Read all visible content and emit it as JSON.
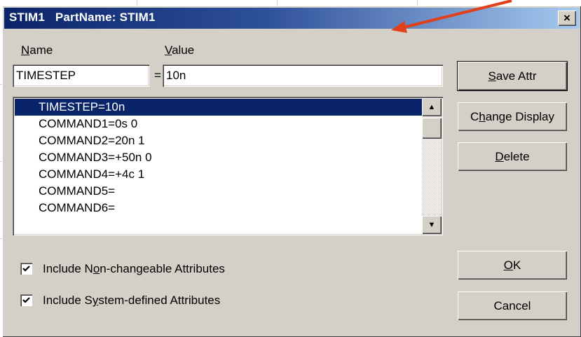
{
  "window": {
    "title": "STIM1   PartName: STIM1",
    "close_label": "×"
  },
  "name_label": "Name",
  "value_label": "Value",
  "name_field": {
    "value": "TIMESTEP"
  },
  "equals": "=",
  "value_field": {
    "value": "10n"
  },
  "attributes": [
    {
      "text": "TIMESTEP=10n",
      "selected": true
    },
    {
      "text": "COMMAND1=0s 0",
      "selected": false
    },
    {
      "text": "COMMAND2=20n 1",
      "selected": false
    },
    {
      "text": "COMMAND3=+50n 0",
      "selected": false
    },
    {
      "text": "COMMAND4=+4c 1",
      "selected": false
    },
    {
      "text": "COMMAND5=",
      "selected": false
    },
    {
      "text": "COMMAND6=",
      "selected": false
    }
  ],
  "buttons": {
    "save_attr": "Save Attr",
    "change_display": "Change Display",
    "delete": "Delete",
    "ok": "OK",
    "cancel": "Cancel"
  },
  "checkboxes": {
    "non_changeable": {
      "label": "Include Non-changeable Attributes",
      "checked": true
    },
    "system_defined": {
      "label": "Include System-defined Attributes",
      "checked": true
    }
  },
  "annotation_arrow_color": "#e0401a",
  "selection_color": "#0a246a"
}
